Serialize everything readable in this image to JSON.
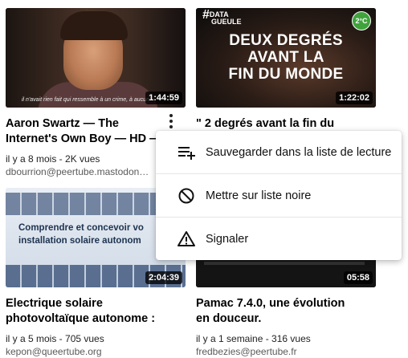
{
  "videos": [
    {
      "title": "Aaron Swartz — The Internet's Own Boy — HD —",
      "duration": "1:44:59",
      "meta": "il y a 8 mois - 2K vues",
      "account": "dbourrion@peertube.mastodon…",
      "subtitle_text": "il n'avait rien fait qui ressemble à un crime, à aucun"
    },
    {
      "title": "\" 2 degrés avant la fin du monde \" - #DATAGUEULE",
      "duration": "1:22:02",
      "thumb_logo_hash": "#",
      "thumb_logo_line1": "DATA",
      "thumb_logo_line2": "GUEULE",
      "thumb_badge": "2°C",
      "thumb_headline": [
        "DEUX DEGRÉS",
        "AVANT LA",
        "FIN DU MONDE"
      ]
    },
    {
      "title": "Electrique solaire photovoltaïque autonome :",
      "duration": "2:04:39",
      "meta": "il y a 5 mois - 705 vues",
      "account": "kepon@queertube.org",
      "thumb_text": [
        "Comprendre et concevoir vo",
        "installation solaire autonom"
      ]
    },
    {
      "title": "Pamac 7.4.0, une évolution en douceur.",
      "duration": "05:58",
      "meta": "il y a 1 semaine - 316 vues",
      "account": "fredbezies@peertube.fr"
    }
  ],
  "menu": {
    "items": [
      {
        "label": "Sauvegarder dans la liste de lecture",
        "icon": "playlist-add-icon"
      },
      {
        "label": "Mettre sur liste noire",
        "icon": "blacklist-icon"
      },
      {
        "label": "Signaler",
        "icon": "report-icon"
      }
    ]
  }
}
